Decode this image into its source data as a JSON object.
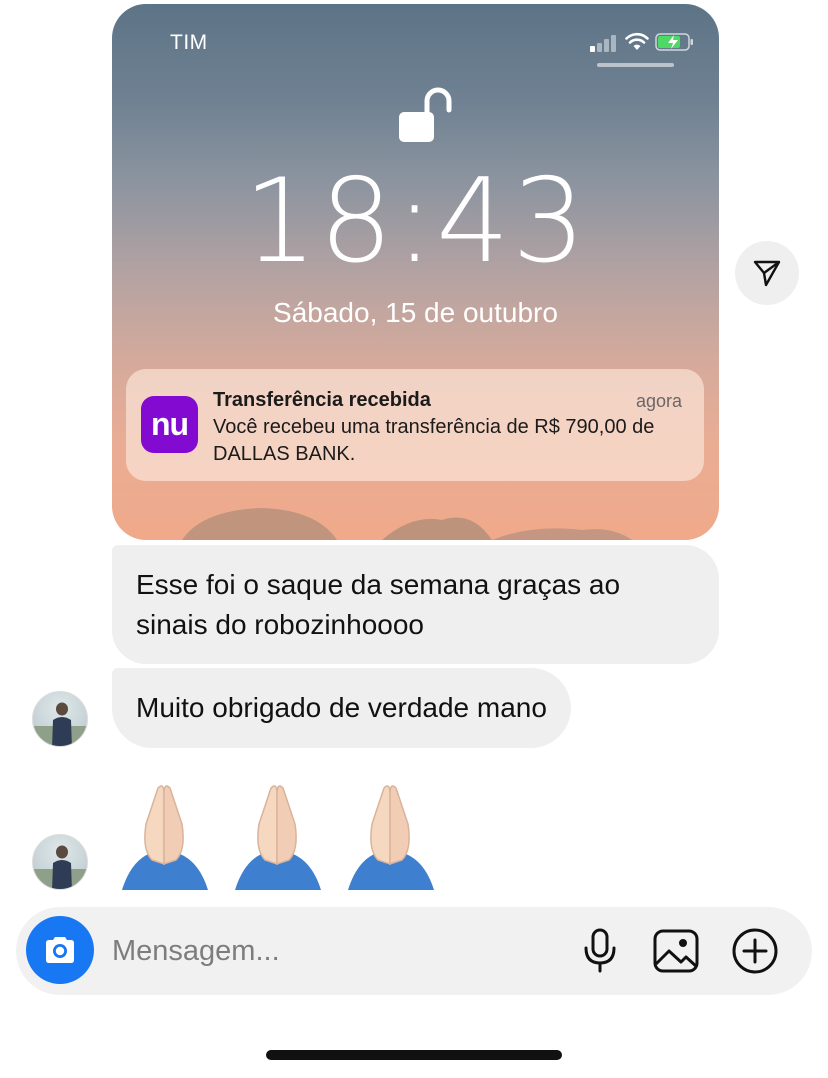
{
  "shared_image": {
    "status_bar": {
      "carrier": "TIM"
    },
    "lock_screen": {
      "time": "18:43",
      "date": "Sábado, 15 de outubro"
    },
    "notification": {
      "app_icon_text": "nu",
      "title": "Transferência recebida",
      "time": "agora",
      "body": "Você recebeu uma transferência de R$ 790,00 de DALLAS BANK."
    }
  },
  "messages": [
    {
      "text": "Esse foi o saque da semana graças ao sinais do robozinhoooo"
    },
    {
      "text": "Muito obrigado de verdade mano"
    },
    {
      "text": "🙏🙏🙏"
    }
  ],
  "composer": {
    "placeholder": "Mensagem..."
  },
  "colors": {
    "bubble_bg": "#efefef",
    "camera_button": "#1877f2",
    "nubank_purple": "#820ad1"
  },
  "icons": [
    "lock-open-icon",
    "send-icon",
    "camera-icon",
    "microphone-icon",
    "image-icon",
    "plus-circle-icon"
  ]
}
